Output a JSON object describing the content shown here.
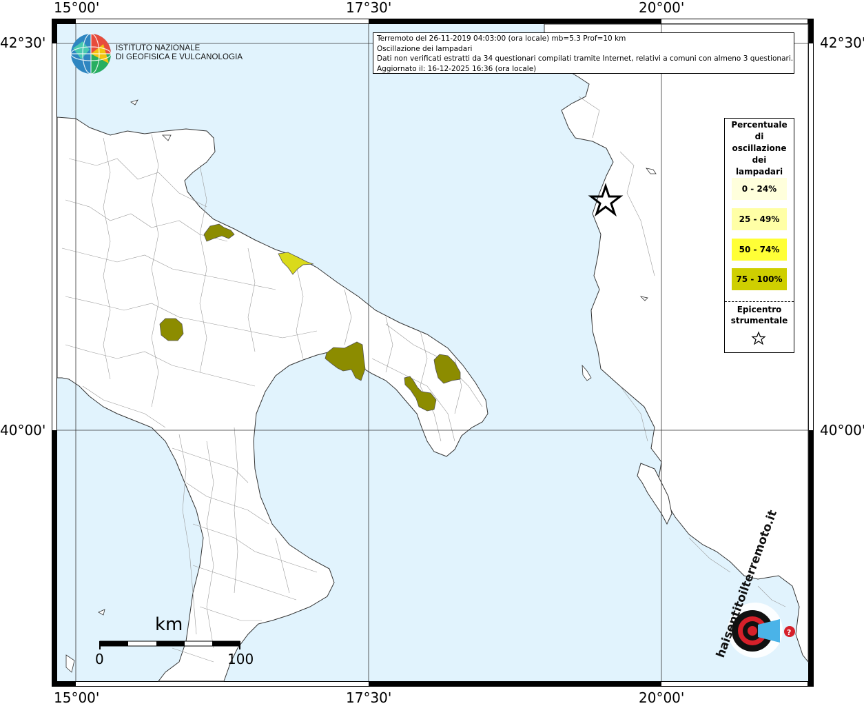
{
  "axis_labels": {
    "top": [
      "15°00'",
      "17°30'",
      "20°00'"
    ],
    "bottom": [
      "15°00'",
      "17°30'",
      "20°00'"
    ],
    "left": [
      "42°30'",
      "40°00'"
    ],
    "right": [
      "42°30'",
      "40°00'"
    ]
  },
  "info": {
    "line1": "Terremoto del 26-11-2019 04:03:00 (ora locale) mb=5.3 Prof=10 km",
    "line2": "Oscillazione dei lampadari",
    "line3": "Dati non verificati estratti da 34 questionari compilati tramite Internet, relativi a comuni con almeno 3 questionari.",
    "line4": "Aggiornato il: 16-12-2025 16:36 (ora locale)"
  },
  "logo": {
    "line1": "ISTITUTO NAZIONALE",
    "line2": "DI GEOFISICA E VULCANOLOGIA"
  },
  "legend": {
    "title": [
      "Percentuale",
      "di",
      "oscillazione",
      "dei",
      "lampadari"
    ],
    "items": [
      {
        "label": "0 - 24%",
        "color": "#ffffdc"
      },
      {
        "label": "25 - 49%",
        "color": "#ffffa6"
      },
      {
        "label": "50 - 74%",
        "color": "#ffff36"
      },
      {
        "label": "75 - 100%",
        "color": "#cfcf00"
      }
    ],
    "epicenter": [
      "Epicentro",
      "strumentale"
    ]
  },
  "scale": {
    "unit": "km",
    "min": "0",
    "max": "100"
  },
  "watermark": {
    "text": "haisentitoilterremoto.it"
  },
  "colors": {
    "sea": "#e1f3fd",
    "land": "#ffffff",
    "affected": "#8c8c00",
    "affected_light": "#dada1a"
  }
}
